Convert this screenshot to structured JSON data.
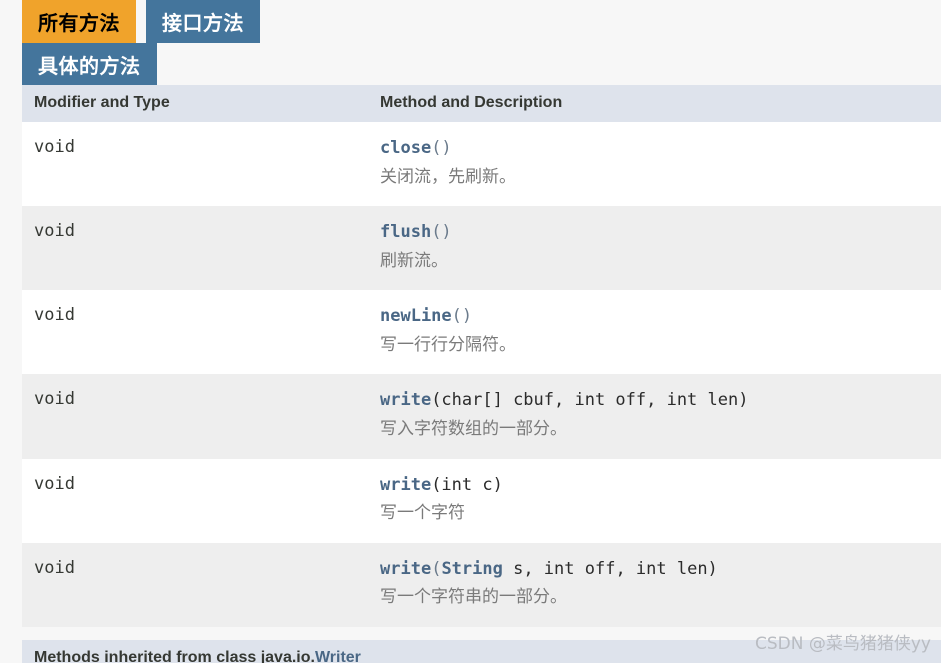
{
  "tabs": {
    "row1": [
      {
        "label": "所有方法",
        "state": "active"
      },
      {
        "label": "接口方法",
        "state": "inactive"
      }
    ],
    "row2": [
      {
        "label": "具体的方法",
        "state": "inactive"
      }
    ]
  },
  "table": {
    "headers": {
      "col1": "Modifier and Type",
      "col2": "Method and Description"
    },
    "rows": [
      {
        "type": "void",
        "method_name": "close",
        "signature_rest": "()",
        "description": "关闭流，先刷新。"
      },
      {
        "type": "void",
        "method_name": "flush",
        "signature_rest": "()",
        "description": "刷新流。"
      },
      {
        "type": "void",
        "method_name": "newLine",
        "signature_rest": "()",
        "description": "写一行行分隔符。"
      },
      {
        "type": "void",
        "method_name": "write",
        "signature_rest": "(char[] cbuf, int off, int len)",
        "description": "写入字符数组的一部分。"
      },
      {
        "type": "void",
        "method_name": "write",
        "signature_rest": "(int c)",
        "description": "写一个字符"
      },
      {
        "type": "void",
        "method_name": "write",
        "signature_param_type": "String",
        "signature_rest": "( s, int off, int len)",
        "signature_prefix": "(",
        "signature_suffix": " s, int off, int len)",
        "description": "写一个字符串的一部分。"
      }
    ]
  },
  "next_section": {
    "prefix": "Methods inherited from class java.io.",
    "link": "Writer"
  },
  "watermark": "CSDN @菜鸟猪猪侠yy",
  "colors": {
    "tab_active": "#f0a32b",
    "tab_inactive": "#44759c",
    "header_bg": "#dee3ec",
    "row_alt_bg": "#eeeeee",
    "link": "#4a6785",
    "page_bg": "#f7f7f7"
  }
}
